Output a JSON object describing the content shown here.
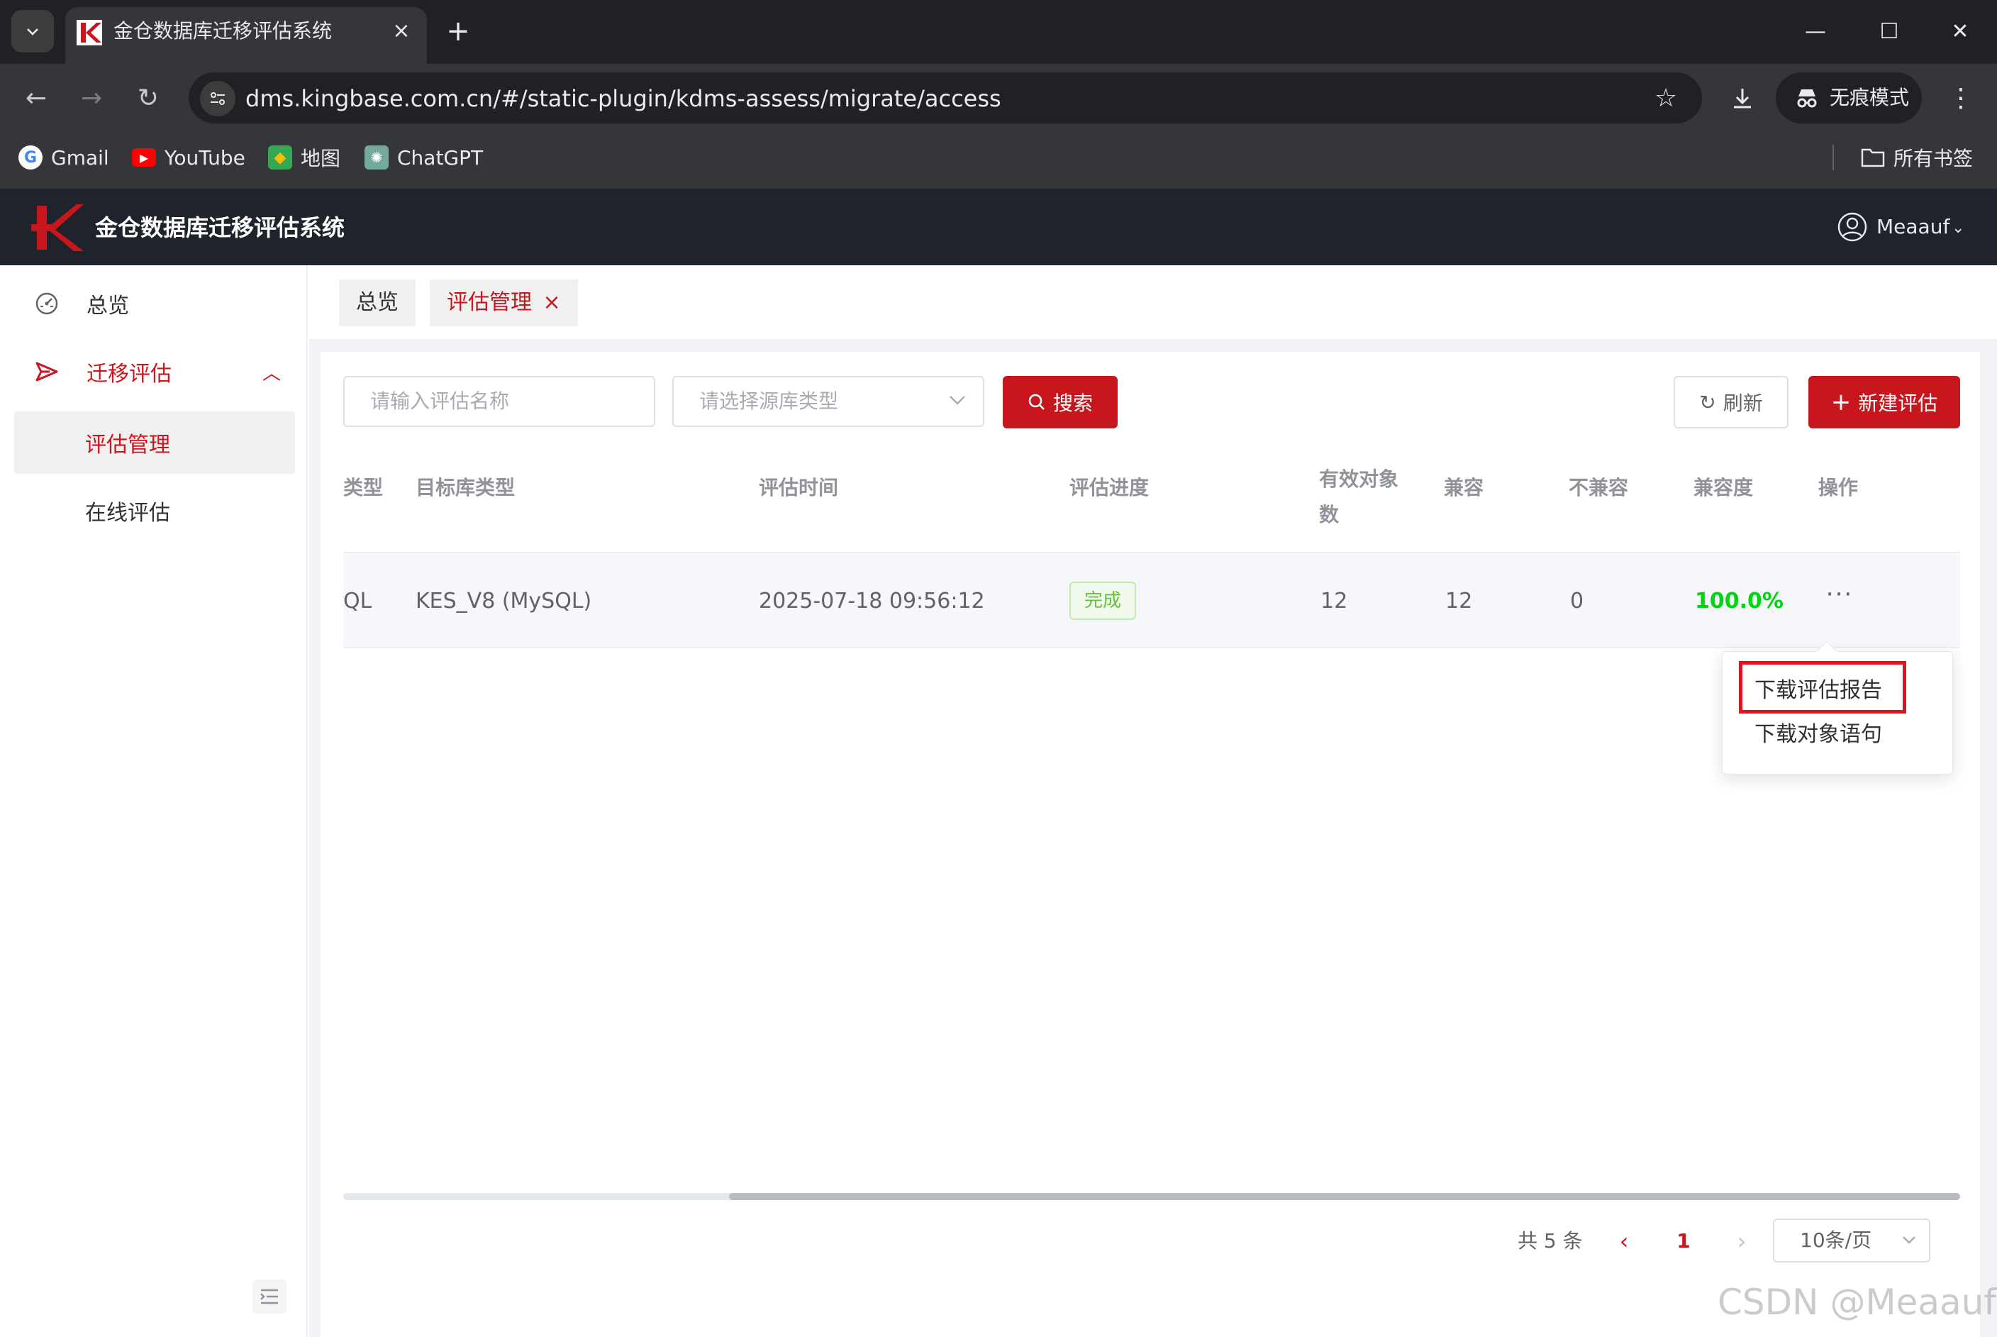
{
  "browser": {
    "tab_title": "金仓数据库迁移评估系统",
    "tab_close": "×",
    "new_tab": "+",
    "url": "dms.kingbase.com.cn/#/static-plugin/kdms-assess/migrate/access",
    "incognito_label": "无痕模式",
    "bookmarks": [
      {
        "label": "Gmail",
        "icon": "google-icon"
      },
      {
        "label": "YouTube",
        "icon": "youtube-icon"
      },
      {
        "label": "地图",
        "icon": "maps-icon"
      },
      {
        "label": "ChatGPT",
        "icon": "chatgpt-icon"
      }
    ],
    "all_bookmarks": "所有书签"
  },
  "app": {
    "title": "金仓数据库迁移评估系统",
    "brand_color": "#c8161e",
    "user": "Meaauf"
  },
  "sidebar": {
    "items": [
      {
        "label": "总览",
        "icon": "dashboard-icon"
      },
      {
        "label": "迁移评估",
        "icon": "send-icon",
        "expanded": true
      },
      {
        "label": "评估管理",
        "active": true
      },
      {
        "label": "在线评估"
      }
    ]
  },
  "tabs": [
    {
      "label": "总览"
    },
    {
      "label": "评估管理",
      "active": true,
      "close": "×"
    }
  ],
  "filters": {
    "name_placeholder": "请输入评估名称",
    "source_placeholder": "请选择源库类型",
    "search_label": "搜索",
    "refresh_label": "刷新",
    "new_label": "新建评估"
  },
  "table": {
    "columns": [
      "类型",
      "目标库类型",
      "评估时间",
      "评估进度",
      "有效对象",
      "数",
      "兼容",
      "不兼容",
      "兼容度",
      "操作"
    ],
    "rows": [
      {
        "source_type_partial": "QL",
        "target_type": "KES_V8 (MySQL)",
        "time": "2025-07-18 09:56:12",
        "progress": "完成",
        "valid_objects": "12",
        "compatible": "12",
        "incompatible": "0",
        "compat_rate": "100.0%",
        "actions": "···"
      }
    ]
  },
  "dropdown": {
    "items": [
      "下载评估报告",
      "下载对象语句"
    ],
    "highlighted": 0
  },
  "pagination": {
    "total": "共 5 条",
    "current_page": "1",
    "page_size": "10条/页"
  },
  "watermark": "CSDN @Meaauf"
}
